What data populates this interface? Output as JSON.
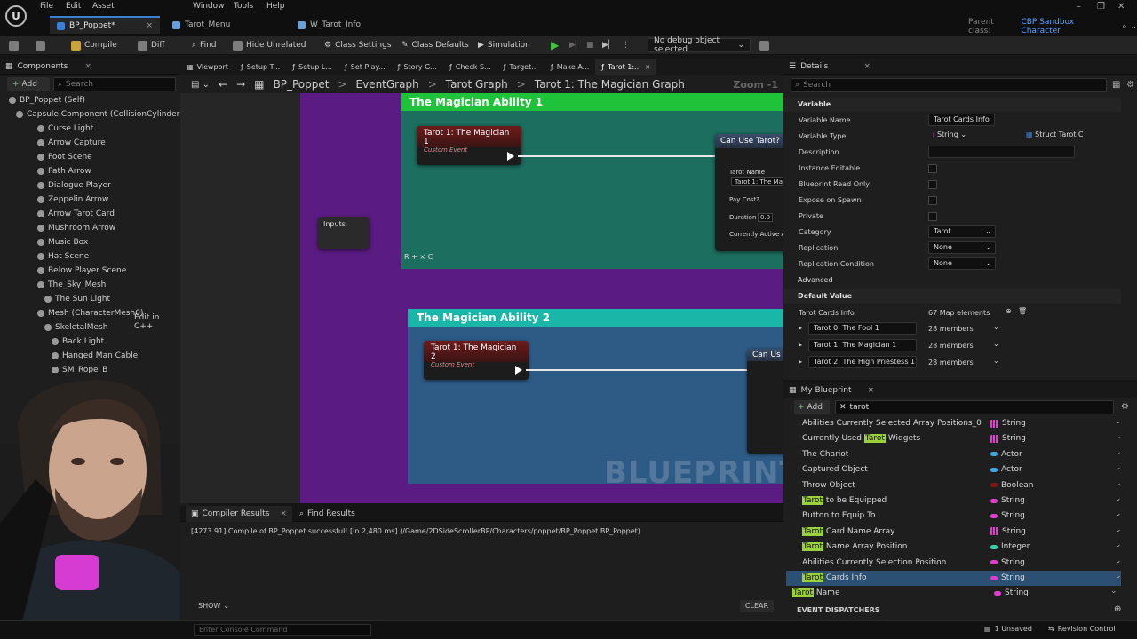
{
  "menu": [
    "File",
    "Edit",
    "Asset",
    "Window",
    "Tools",
    "Help"
  ],
  "doc_tabs": [
    "BP_Poppet*",
    "Tarot_Menu",
    "W_Tarot_Info"
  ],
  "parent_class": {
    "label": "Parent class:",
    "value": "CBP Sandbox Character"
  },
  "toolbar": {
    "compile": "Compile",
    "diff": "Diff",
    "find": "Find",
    "hide_unrelated": "Hide Unrelated",
    "class_settings": "Class Settings",
    "class_defaults": "Class Defaults",
    "simulation": "Simulation",
    "debug_object": "No debug object selected"
  },
  "components": {
    "tab_label": "Components",
    "add_label": "Add",
    "search_placeholder": "Search",
    "items": [
      {
        "label": "BP_Poppet (Self)",
        "indent": 0
      },
      {
        "label": "Capsule Component (CollisionCylinder)",
        "indent": 1
      },
      {
        "label": "Curse Light",
        "indent": 2
      },
      {
        "label": "Arrow Capture",
        "indent": 2
      },
      {
        "label": "Foot Scene",
        "indent": 2
      },
      {
        "label": "Path Arrow",
        "indent": 2
      },
      {
        "label": "Dialogue Player",
        "indent": 2
      },
      {
        "label": "Zeppelin Arrow",
        "indent": 2
      },
      {
        "label": "Arrow Tarot Card",
        "indent": 2
      },
      {
        "label": "Mushroom Arrow",
        "indent": 2
      },
      {
        "label": "Music Box",
        "indent": 2
      },
      {
        "label": "Hat Scene",
        "indent": 2
      },
      {
        "label": "Below Player Scene",
        "indent": 2
      },
      {
        "label": "The_Sky_Mesh",
        "indent": 2
      },
      {
        "label": "The Sun Light",
        "indent": 3
      },
      {
        "label": "Mesh (CharacterMesh0)",
        "indent": 2
      },
      {
        "label": "SkeletalMesh",
        "indent": 3
      },
      {
        "label": "Back Light",
        "indent": 4
      },
      {
        "label": "Hanged Man Cable",
        "indent": 4
      },
      {
        "label": "SM_Rope_B",
        "indent": 4
      }
    ],
    "edit_cpp": "Edit in C++"
  },
  "graph_tabs": [
    "Viewport",
    "Setup T...",
    "Setup L...",
    "Set Play...",
    "Story G...",
    "Check S...",
    "Target...",
    "Make A...",
    "Tarot 1:..."
  ],
  "breadcrumb": [
    "BP_Poppet",
    "EventGraph",
    "Tarot Graph",
    "Tarot 1: The Magician Graph"
  ],
  "zoom": "Zoom -1",
  "comments": [
    {
      "title": "The Magician Ability 1",
      "event": "Tarot 1: The Magician 1",
      "sub": "Custom Event"
    },
    {
      "title": "The Magician Ability 2",
      "event": "Tarot 1: The Magician 2",
      "sub": "Custom Event"
    }
  ],
  "can_use_node": {
    "title": "Can Use Tarot?",
    "tarot_name_label": "Tarot Name",
    "tarot_name_value": "Tarot 1: The Ma",
    "pay_cost": "Pay Cost?",
    "duration_label": "Duration",
    "duration_value": "0.0",
    "currently_active": "Currently Active A"
  },
  "can_use_short": "Can Us",
  "inputs_node": "Inputs",
  "comment_footer": "R + × C",
  "watermark": "BLUEPRINT",
  "details": {
    "tab_label": "Details",
    "search_placeholder": "Search",
    "section_variable": "Variable",
    "rows": [
      {
        "name": "Variable Name",
        "value": "Tarot Cards Info",
        "kind": "text"
      },
      {
        "name": "Variable Type",
        "value": "String",
        "kind": "type"
      },
      {
        "name": "Description",
        "value": "",
        "kind": "text"
      },
      {
        "name": "Instance Editable",
        "value": "",
        "kind": "check"
      },
      {
        "name": "Blueprint Read Only",
        "value": "",
        "kind": "check"
      },
      {
        "name": "Expose on Spawn",
        "value": "",
        "kind": "check"
      },
      {
        "name": "Private",
        "value": "",
        "kind": "check"
      },
      {
        "name": "Category",
        "value": "Tarot",
        "kind": "combo"
      },
      {
        "name": "Replication",
        "value": "None",
        "kind": "combo"
      },
      {
        "name": "Replication Condition",
        "value": "None",
        "kind": "combo"
      }
    ],
    "value_type": "Struct Tarot C",
    "section_advanced": "Advanced",
    "section_default": "Default Value",
    "default_label": "Tarot Cards Info",
    "map_count": "67 Map elements",
    "map_entries": [
      {
        "key": "Tarot 0: The Fool 1",
        "members": "28 members"
      },
      {
        "key": "Tarot 1: The Magician 1",
        "members": "28 members"
      },
      {
        "key": "Tarot 2: The High Priestess 1",
        "members": "28 members"
      }
    ]
  },
  "my_blueprint": {
    "tab_label": "My Blueprint",
    "add_label": "Add",
    "search_value": "tarot",
    "variables": [
      {
        "pre": "Abilities Currently Selected Array Positions_0",
        "hl": "",
        "post": "",
        "type": "String",
        "color": "#e23bd0",
        "array": true
      },
      {
        "pre": "Currently Used ",
        "hl": "Tarot",
        "post": " Widgets",
        "type": "String",
        "color": "#e23bd0",
        "array": true
      },
      {
        "pre": "The Chariot",
        "hl": "",
        "post": "",
        "type": "Actor",
        "color": "#3aa7e8",
        "array": false
      },
      {
        "pre": "Captured Object",
        "hl": "",
        "post": "",
        "type": "Actor",
        "color": "#3aa7e8",
        "array": false
      },
      {
        "pre": "Throw Object",
        "hl": "",
        "post": "",
        "type": "Boolean",
        "color": "#8b1212",
        "array": false
      },
      {
        "pre": "",
        "hl": "Tarot",
        "post": " to be Equipped",
        "type": "String",
        "color": "#e23bd0",
        "array": false
      },
      {
        "pre": "Button to Equip To",
        "hl": "",
        "post": "",
        "type": "String",
        "color": "#e23bd0",
        "array": false
      },
      {
        "pre": "",
        "hl": "Tarot",
        "post": " Card Name Array",
        "type": "String",
        "color": "#e23bd0",
        "array": true
      },
      {
        "pre": "",
        "hl": "Tarot",
        "post": " Name Array Position",
        "type": "Integer",
        "color": "#2ed3a6",
        "array": false
      },
      {
        "pre": "Abilities Currently Selection Position",
        "hl": "",
        "post": "",
        "type": "String",
        "color": "#e23bd0",
        "array": false
      },
      {
        "pre": "",
        "hl": "Tarot",
        "post": " Cards Info",
        "type": "String",
        "color": "#e23bd0",
        "array": false
      },
      {
        "pre": "",
        "hl": "Tarot",
        "post": " Name",
        "type": "String",
        "color": "#e23bd0",
        "array": false
      }
    ],
    "event_dispatchers": "EVENT DISPATCHERS"
  },
  "compiler": {
    "tab_label": "Compiler Results",
    "find_results": "Find Results",
    "message": "[4273.91] Compile of BP_Poppet successful! [in 2,480 ms] (/Game/2DSideScrollerBP/Characters/poppet/BP_Poppet.BP_Poppet)",
    "show": "SHOW",
    "clear": "CLEAR"
  },
  "status": {
    "console_placeholder": "Enter Console Command",
    "unsaved": "1 Unsaved",
    "revision": "Revision Control"
  },
  "colors": {
    "comment1_head": "#1fc33a",
    "comment1_body": "#1c6e5e",
    "comment2_head": "#1ab6a8",
    "comment2_body": "#2e5b86",
    "purple_bg": "#5a1b82",
    "selected_row": "#2c4f74",
    "search_highlight": "#9bd23b"
  }
}
